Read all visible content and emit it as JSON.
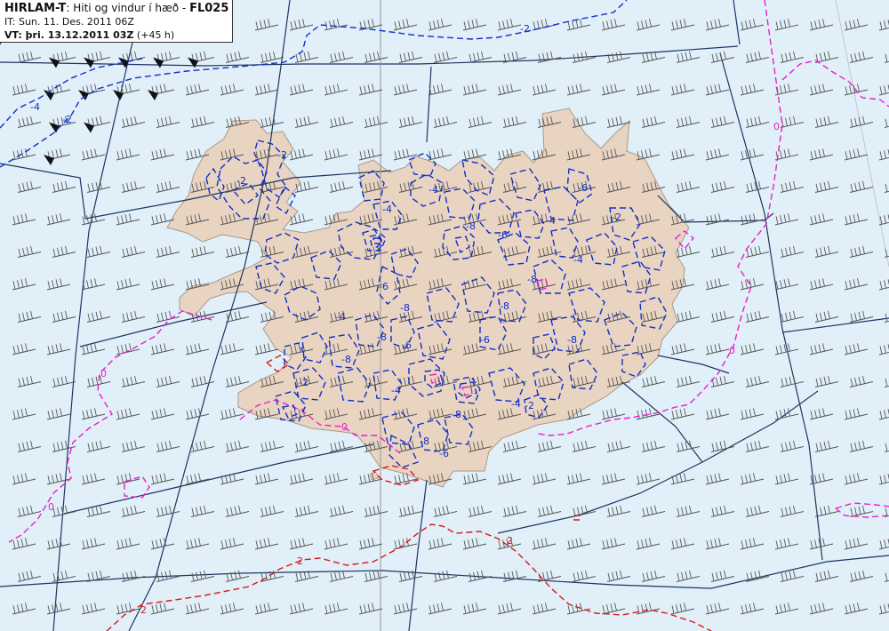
{
  "header": {
    "model": "HIRLAM-T",
    "description": ": Hiti og vindur í hæð - ",
    "level": "FL025",
    "init_time": "IT: Sun. 11. Des. 2011 06Z",
    "valid_prefix": "VT: ",
    "valid_time": "þri. 13.12.2011 03Z",
    "forecast_hour": " (+45 h)"
  },
  "colors": {
    "sea": "#e0eff8",
    "land": "#e9d3c1",
    "coast": "#a99a8a",
    "grid": "#1e3560",
    "cold_contour": "#1030c8",
    "zero_contour": "#e820c8",
    "warm_contour": "#d81818",
    "wind_barb": "#555555"
  },
  "contour_labels": {
    "minus2": "-2",
    "minus4": "-4",
    "minus6": "-6",
    "minus8": "-8",
    "zero": "0",
    "plus2": "2"
  }
}
